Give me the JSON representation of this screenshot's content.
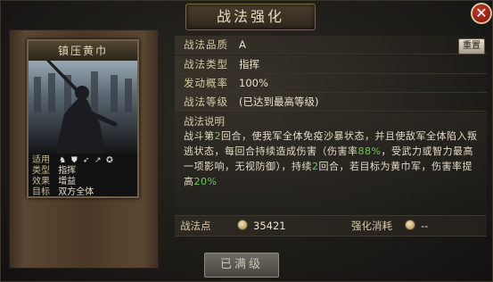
{
  "header": {
    "title": "战法强化"
  },
  "card": {
    "name": "镇压黄巾",
    "rows": [
      {
        "key": "适用",
        "value": ""
      },
      {
        "key": "类型",
        "value": "指挥"
      },
      {
        "key": "效果",
        "value": "增益"
      },
      {
        "key": "目标",
        "value": "双方全体"
      }
    ],
    "unit_icons": [
      "cavalry-icon",
      "shield-icon",
      "archer-icon",
      "spear-icon",
      "siege-icon"
    ]
  },
  "attributes": [
    {
      "key": "战法品质",
      "value": "A"
    },
    {
      "key": "战法类型",
      "value": "指挥"
    },
    {
      "key": "发动概率",
      "value": "100%"
    },
    {
      "key": "战法等级",
      "value": "(已达到最高等级)"
    }
  ],
  "reset_button": "重置",
  "description": {
    "title": "战法说明",
    "segments": [
      {
        "text": "战斗第",
        "hl": false
      },
      {
        "text": "2",
        "hl": true
      },
      {
        "text": "回合，使我军全体免疫沙暴状态，并且使敌军全体陷入叛逃状态，每回合持续造成伤害（伤害率",
        "hl": false
      },
      {
        "text": "88%",
        "hl": true
      },
      {
        "text": "，受武力或智力最高一项影响，无视防御），持续",
        "hl": false
      },
      {
        "text": "2",
        "hl": true
      },
      {
        "text": "回合，若目标为黄巾军，伤害率提高",
        "hl": false
      },
      {
        "text": "20%",
        "hl": true
      }
    ]
  },
  "bottom": {
    "points_label": "战法点",
    "points_value": "35421",
    "cost_label": "强化消耗",
    "cost_value": "--"
  },
  "maxed_button": "已满级",
  "colors": {
    "highlight": "#73c45b",
    "gold": "#d7c9a6",
    "close": "#c43a2a"
  }
}
